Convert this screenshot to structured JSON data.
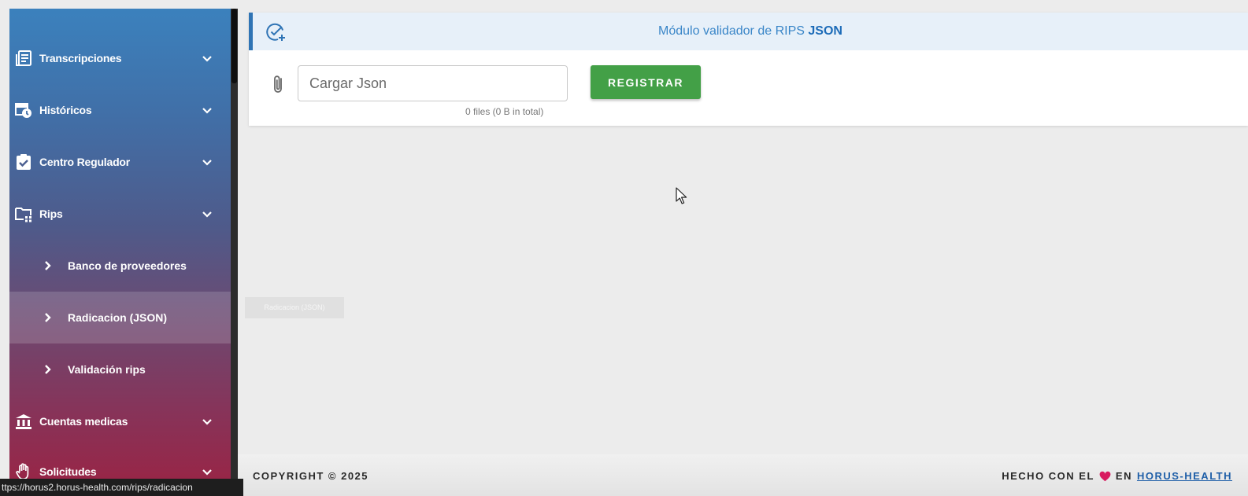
{
  "sidebar": {
    "items": [
      {
        "label": "Transcripciones",
        "icon": "list-document-icon"
      },
      {
        "label": "Históricos",
        "icon": "calendar-clock-icon"
      },
      {
        "label": "Centro Regulador",
        "icon": "clipboard-check-icon"
      },
      {
        "label": "Rips",
        "icon": "folder-network-icon"
      }
    ],
    "rips_subitems": [
      {
        "label": "Banco de proveedores"
      },
      {
        "label": "Radicacion (JSON)",
        "active": true
      },
      {
        "label": "Validación rips"
      }
    ],
    "items_bottom": [
      {
        "label": "Cuentas medicas",
        "icon": "bank-icon"
      },
      {
        "label": "Solicitudes",
        "icon": "hand-icon"
      }
    ]
  },
  "tooltip": "Radicacion (JSON)",
  "status_url": "ttps://horus2.horus-health.com/rips/radicacion",
  "module": {
    "title_prefix": "Módulo validador de RIPS",
    "title_bold": "JSON",
    "file_placeholder": "Cargar Json",
    "file_count": "0 files (0 B in total)",
    "register_label": "REGISTRAR"
  },
  "footer": {
    "copyright": "COPYRIGHT © 2025",
    "made_prefix": "HECHO CON EL",
    "made_middle": "EN",
    "link": "HORUS-HEALTH"
  },
  "colors": {
    "accent": "#2f74b5",
    "register_button": "#43a047",
    "heart": "#d81b60"
  }
}
